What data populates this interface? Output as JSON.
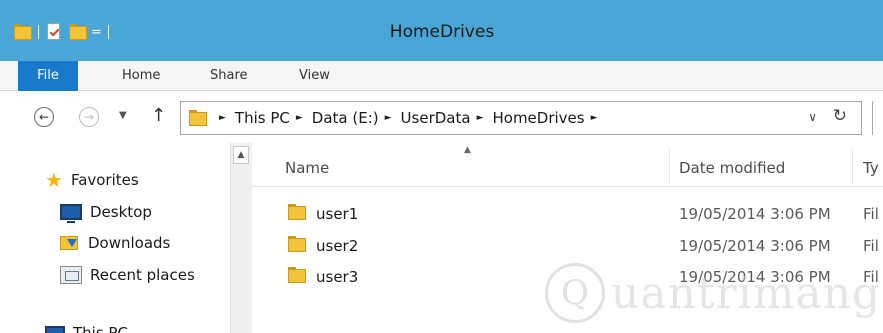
{
  "window": {
    "title": "HomeDrives",
    "qat_dropdown": "="
  },
  "ribbon": {
    "tabs": [
      {
        "label": "File"
      },
      {
        "label": "Home"
      },
      {
        "label": "Share"
      },
      {
        "label": "View"
      }
    ]
  },
  "nav": {
    "back_glyph": "←",
    "forward_glyph": "→",
    "recent_glyph": "▼",
    "up_glyph": "↑"
  },
  "address": {
    "crumbs": [
      "This PC",
      "Data (E:)",
      "UserData",
      "HomeDrives"
    ],
    "separator": "►",
    "dropdown_glyph": "∨",
    "refresh_glyph": "↻"
  },
  "navpane": {
    "favorites": "Favorites",
    "items": [
      "Desktop",
      "Downloads",
      "Recent places"
    ],
    "this_pc": "This PC",
    "scroll_up_glyph": "▲"
  },
  "filelist": {
    "columns": {
      "name": "Name",
      "date": "Date modified",
      "type": "Ty"
    },
    "sort_glyph": "▲",
    "rows": [
      {
        "name": "user1",
        "date": "19/05/2014 3:06 PM",
        "type": "Fil"
      },
      {
        "name": "user2",
        "date": "19/05/2014 3:06 PM",
        "type": "Fil"
      },
      {
        "name": "user3",
        "date": "19/05/2014 3:06 PM",
        "type": "Fil"
      }
    ]
  },
  "watermark": {
    "mark": "Q",
    "text": "uantrimang"
  },
  "colors": {
    "titlebar": "#4aa6d6",
    "file_tab": "#1979ca",
    "folder": "#f3c437"
  }
}
